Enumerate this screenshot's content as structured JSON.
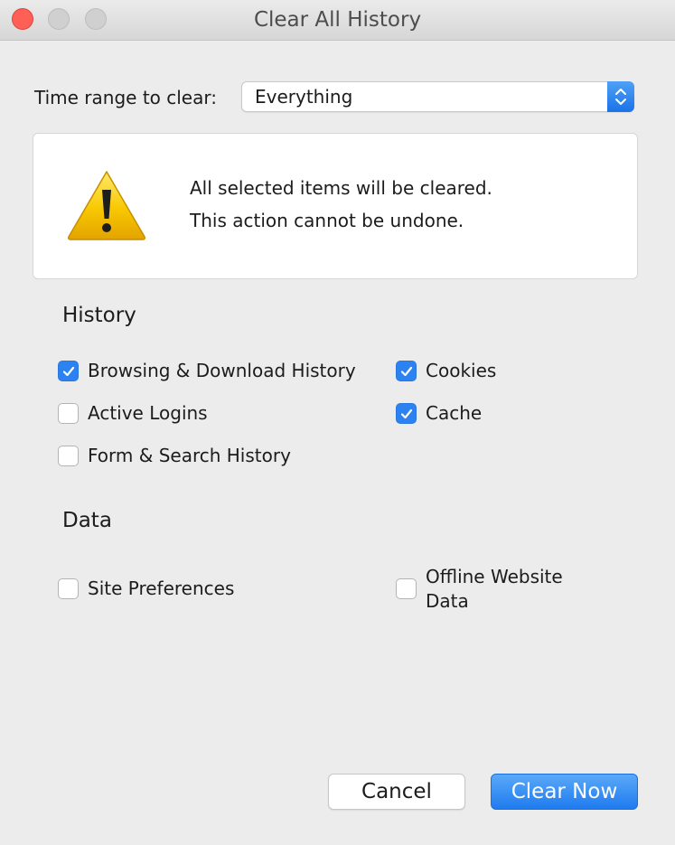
{
  "window": {
    "title": "Clear All History"
  },
  "time_range": {
    "label": "Time range to clear:",
    "selected": "Everything"
  },
  "warning": {
    "line1": "All selected items will be cleared.",
    "line2": "This action cannot be undone."
  },
  "history": {
    "title": "History",
    "items": [
      {
        "label": "Browsing & Download History",
        "checked": true
      },
      {
        "label": "Cookies",
        "checked": true
      },
      {
        "label": "Active Logins",
        "checked": false
      },
      {
        "label": "Cache",
        "checked": true
      },
      {
        "label": "Form & Search History",
        "checked": false
      }
    ]
  },
  "data_section": {
    "title": "Data",
    "items": [
      {
        "label": "Site Preferences",
        "checked": false
      },
      {
        "label_line1": "Offline Website",
        "label_line2": "Data",
        "checked": false
      }
    ]
  },
  "buttons": {
    "cancel": "Cancel",
    "clear_now": "Clear Now"
  },
  "colors": {
    "accent": "#2d82f1",
    "close": "#fe5f57",
    "warning": "#f5c400"
  },
  "icons": {
    "warning": "warning-triangle-icon",
    "checkmark": "checkmark-icon",
    "stepper": "up-down-chevron-icon"
  }
}
